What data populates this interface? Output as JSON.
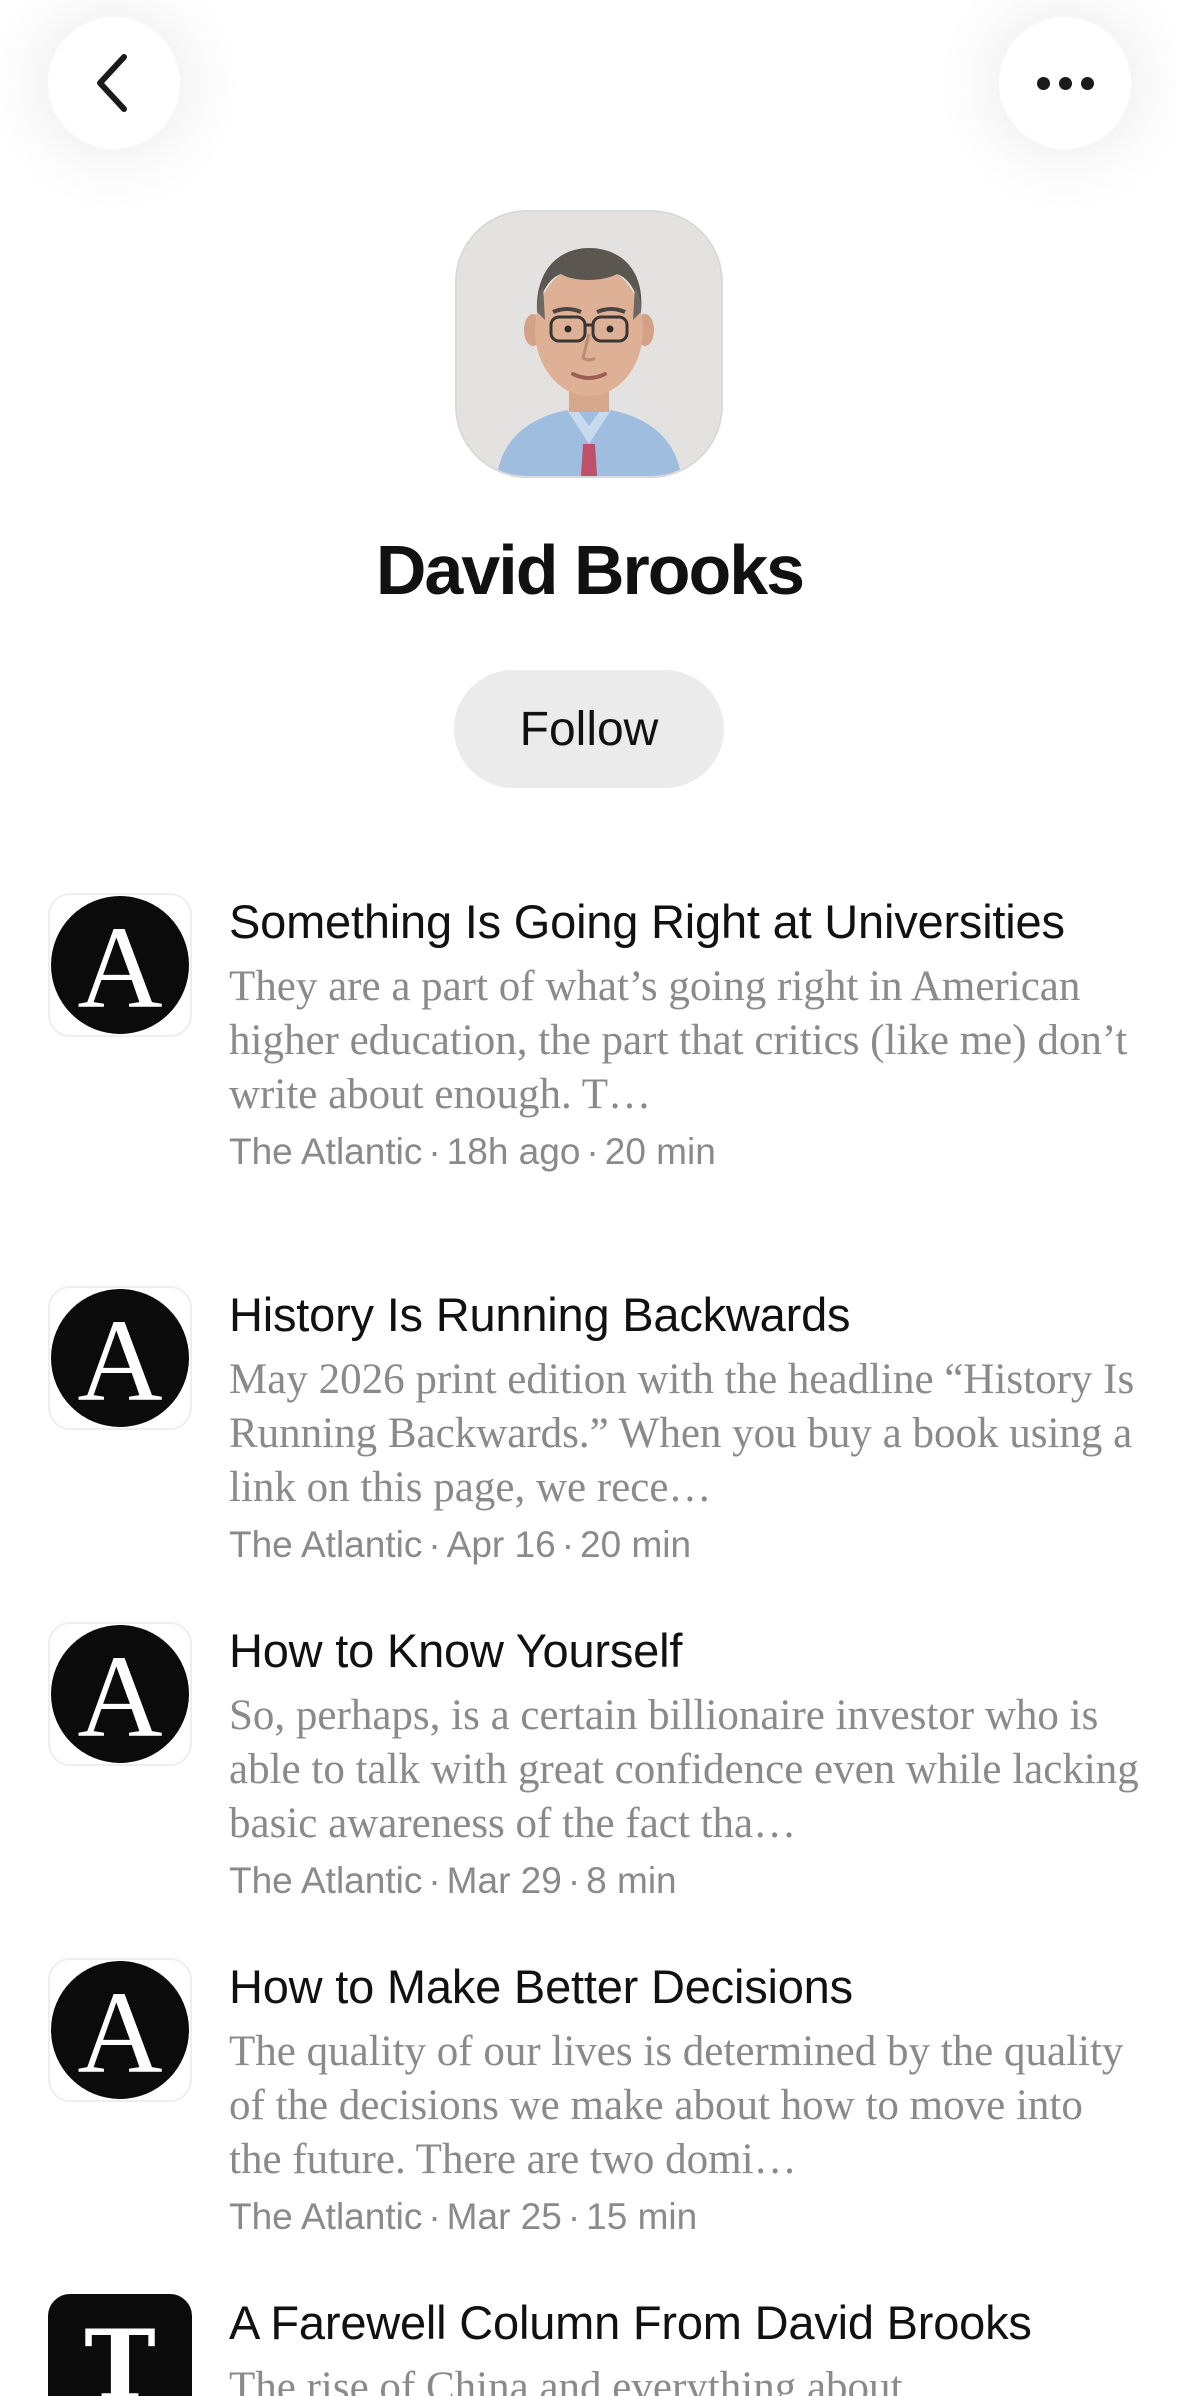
{
  "nav": {
    "back_icon": "chevron-left-icon",
    "more_icon": "ellipsis-icon"
  },
  "profile": {
    "name": "David Brooks",
    "follow_label": "Follow"
  },
  "articles": [
    {
      "logo": "A",
      "title": "Something Is Going Right at Universities",
      "excerpt": "They are a part of what’s going right in American higher education, the part that critics (like me) don’t write about enough. T…",
      "source": "The Atlantic",
      "time": "18h ago",
      "duration": "20 min"
    },
    {
      "logo": "A",
      "title": "History Is Running Backwards",
      "excerpt": "May 2026 print edition with the headline “History Is Running Backwards.” When you buy a book using a link on this page, we rece…",
      "source": "The Atlantic",
      "time": "Apr 16",
      "duration": "20 min"
    },
    {
      "logo": "A",
      "title": "How to Know Yourself",
      "excerpt": "So, perhaps, is a certain billionaire investor who is able to talk with great confidence even while lacking basic awareness of the fact tha…",
      "source": "The Atlantic",
      "time": "Mar 29",
      "duration": "8 min"
    },
    {
      "logo": "A",
      "title": "How to Make Better Decisions",
      "excerpt": "The quality of our lives is determined by the quality of the decisions we make about how to move into the future. There are two domi…",
      "source": "The Atlantic",
      "time": "Mar 25",
      "duration": "15 min"
    },
    {
      "logo": "T",
      "title": "A Farewell Column From David Brooks",
      "excerpt": "The rise of China and everything about",
      "source": "",
      "time": "",
      "duration": ""
    }
  ],
  "meta_separator": "·"
}
